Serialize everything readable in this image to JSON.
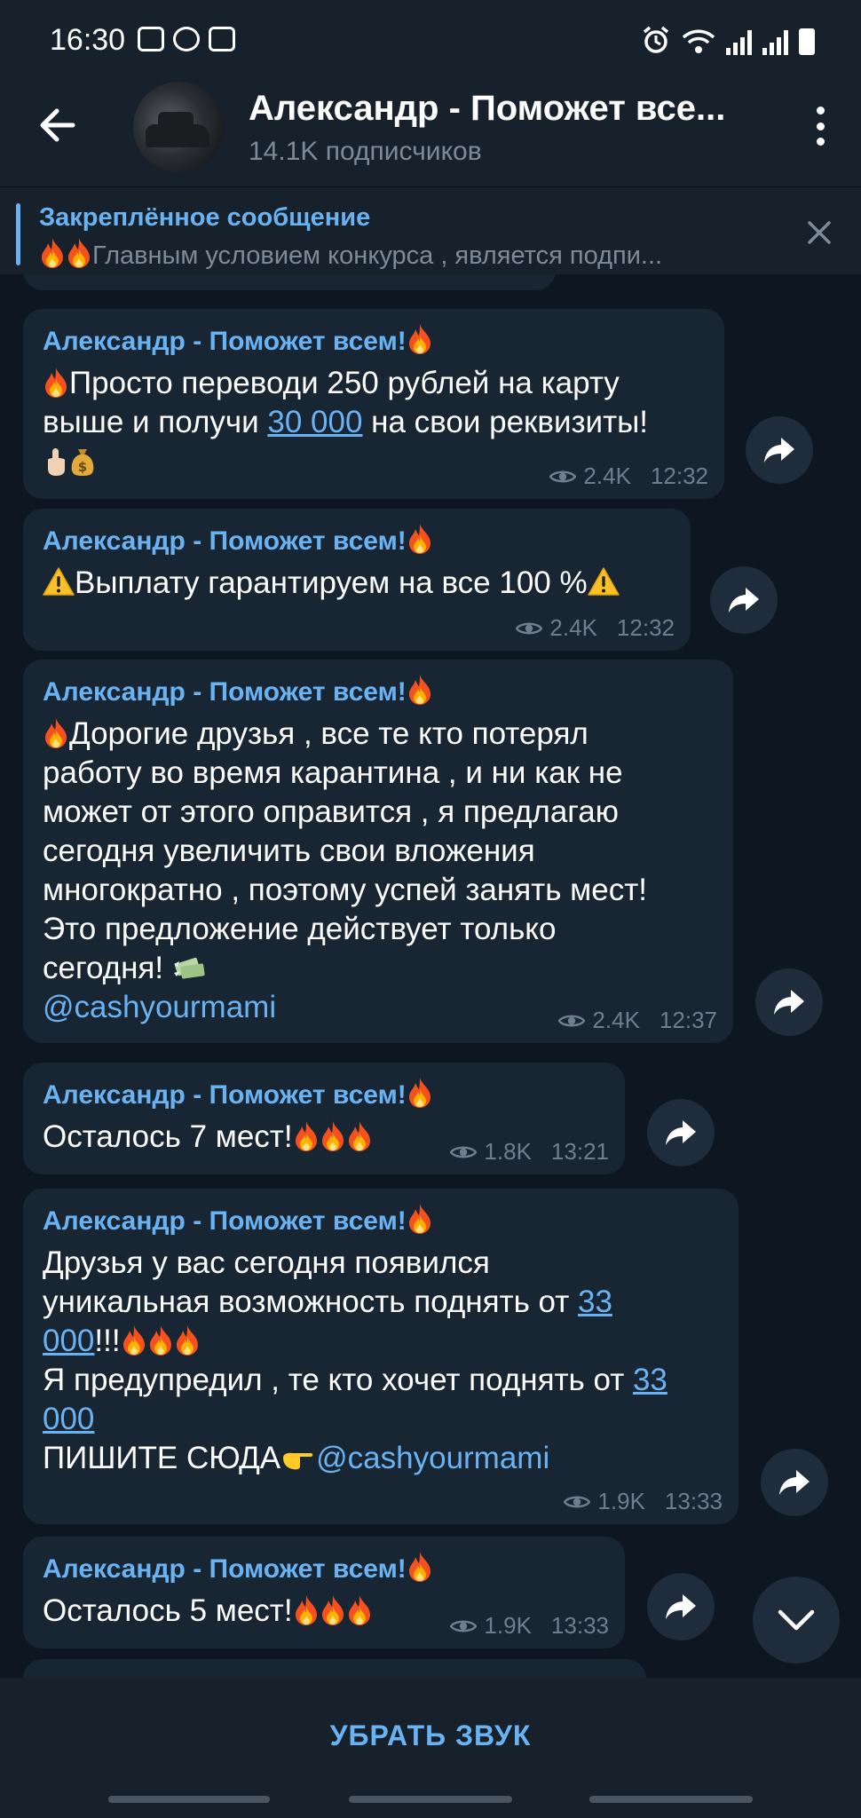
{
  "status_bar": {
    "time": "16:30"
  },
  "header": {
    "title": "Александр - Поможет все...",
    "subscribers": "14.1K подписчиков"
  },
  "pinned": {
    "label": "Закреплённое сообщение",
    "text": "Главным условием конкурса , является подпи..."
  },
  "messages": [
    {
      "author": "Александр - Поможет всем!",
      "line1": "Просто переводи 250 рублей на карту",
      "line2_a": "выше и получи ",
      "line2_link": "30 000",
      "line2_b": " на свои реквизиты!",
      "views": "2.4K",
      "time": "12:32"
    },
    {
      "author": "Александр - Поможет всем!",
      "text": "Выплату гарантируем на все 100 %",
      "views": "2.4K",
      "time": "12:32"
    },
    {
      "author": "Александр - Поможет всем!",
      "lines": [
        "Дорогие друзья , все те кто потерял",
        "работу во время карантина , и ни как не",
        "может от этого оправится , я предлагаю",
        "сегодня увеличить свои вложения",
        "многократно , поэтому успей занять мест!",
        "Это предложение действует только",
        "сегодня!"
      ],
      "mention": "@cashyourmami",
      "views": "2.4K",
      "time": "12:37"
    },
    {
      "author": "Александр - Поможет всем!",
      "text": "Осталось 7 мест!",
      "views": "1.8K",
      "time": "13:21"
    },
    {
      "author": "Александр - Поможет всем!",
      "line1": "Друзья у вас сегодня появился",
      "line2_a": "уникальная возможность поднять от ",
      "line2_link": "33",
      "line3_link": "000",
      "line3_b": "!!!",
      "line4_a": "Я предупредил , те кто хочет поднять от ",
      "line4_link": "33",
      "line5_link": "000",
      "line6_a": "ПИШИТЕ СЮДА",
      "line6_mention": "@cashyourmami",
      "views": "1.9K",
      "time": "13:33"
    },
    {
      "author": "Александр - Поможет всем!",
      "text": "Осталось 5 мест!",
      "views": "1.9K",
      "time": "13:33"
    }
  ],
  "bottom": {
    "mute_label": "УБРАТЬ ЗВУК"
  },
  "colors": {
    "accent": "#6ab3f3",
    "bubble": "#182533",
    "background": "#0e1621",
    "header": "#17212b"
  }
}
